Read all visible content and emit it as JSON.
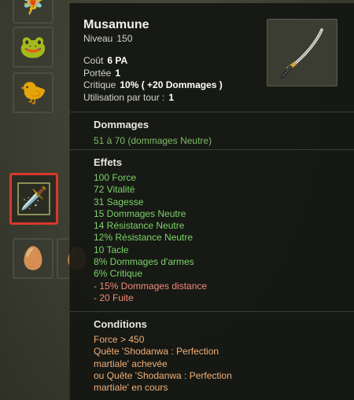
{
  "item": {
    "name": "Musamune",
    "level_label": "Niveau",
    "level": "150",
    "stats": [
      {
        "key": "Coût",
        "value": "6 PA"
      },
      {
        "key": "Portée",
        "value": "1"
      },
      {
        "key": "Critique",
        "value": "10% ( +20 Dommages )"
      },
      {
        "key": "Utilisation par tour :",
        "value": "1"
      }
    ],
    "thumb_icon": "katana-icon"
  },
  "damage": {
    "title": "Dommages",
    "line": "51 à 70 (dommages Neutre)"
  },
  "effects": {
    "title": "Effets",
    "lines": [
      {
        "text": "100 Force",
        "kind": "pos"
      },
      {
        "text": "72 Vitalité",
        "kind": "pos"
      },
      {
        "text": "31 Sagesse",
        "kind": "pos"
      },
      {
        "text": "15 Dommages Neutre",
        "kind": "pos"
      },
      {
        "text": "14 Résistance Neutre",
        "kind": "pos"
      },
      {
        "text": "12% Résistance Neutre",
        "kind": "pos"
      },
      {
        "text": "10 Tacle",
        "kind": "pos"
      },
      {
        "text": "8% Dommages d'armes",
        "kind": "pos"
      },
      {
        "text": "6% Critique",
        "kind": "pos"
      },
      {
        "text": "- 15% Dommages distance",
        "kind": "neg"
      },
      {
        "text": "- 20 Fuite",
        "kind": "neg"
      }
    ]
  },
  "conditions": {
    "title": "Conditions",
    "lines": [
      "Force > 450",
      "Quête 'Shodanwa : Perfection",
      "martiale' achevée",
      "ou Quête 'Shodanwa : Perfection",
      "martiale' en cours"
    ]
  },
  "colors": {
    "positive": "#7cd36a",
    "negative": "#f28a7a",
    "condition": "#f2b07a",
    "selection": "#d8382c"
  }
}
